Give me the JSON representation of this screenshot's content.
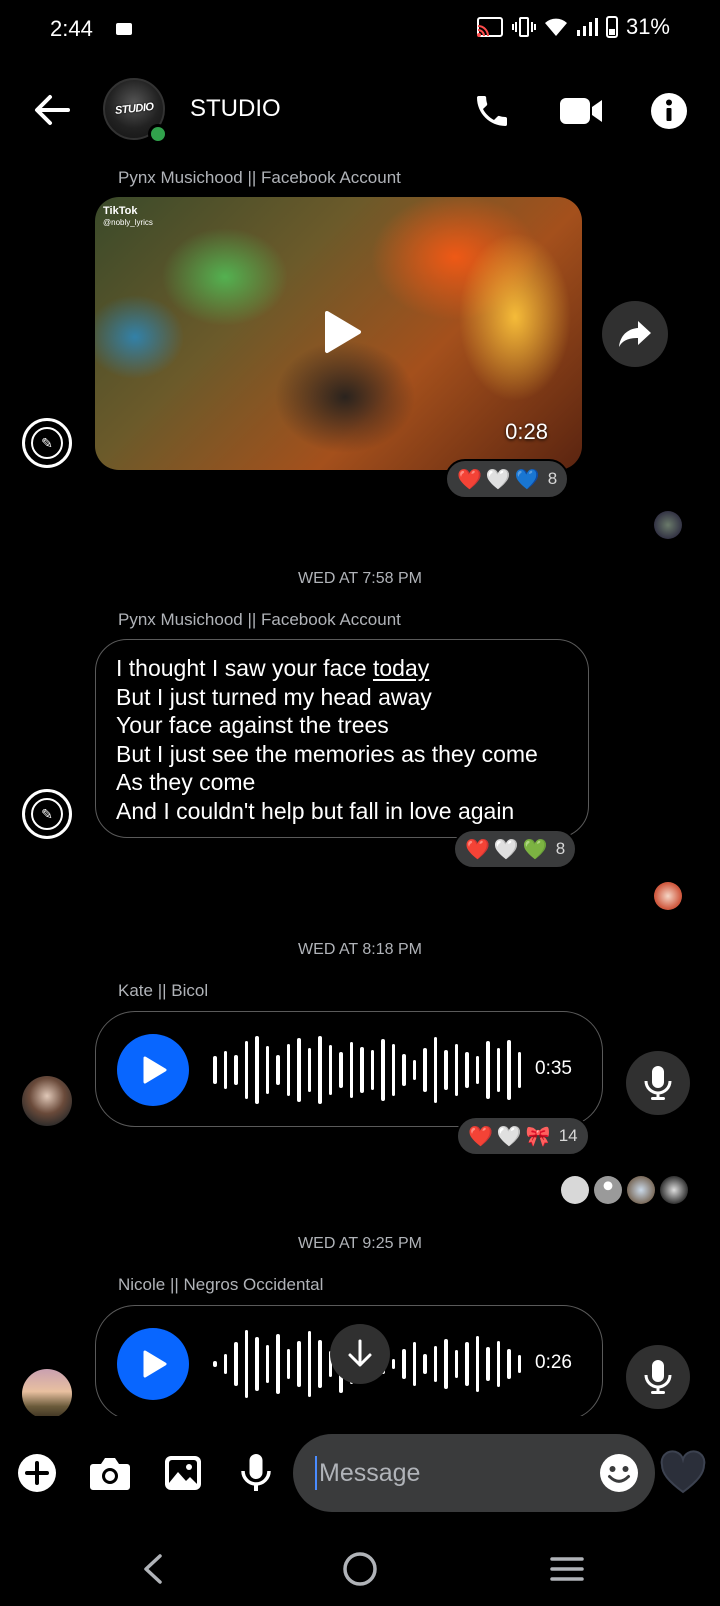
{
  "status_bar": {
    "time": "2:44",
    "battery": "31%"
  },
  "header": {
    "title": "STUDIO",
    "avatar_text": "STUDIO"
  },
  "messages": [
    {
      "sender": "Pynx Musichood || Facebook Account",
      "video": {
        "watermark": "TikTok",
        "watermark_handle": "@nobly_lyrics",
        "duration": "0:28"
      },
      "reactions": [
        "❤️",
        "🤍",
        "💙"
      ],
      "reaction_count": "8"
    },
    {
      "timestamp": "WED AT 7:58 PM",
      "sender": "Pynx Musichood || Facebook Account",
      "text_lines": [
        "I thought I saw your face ",
        "today",
        "But I just turned my head away",
        "Your face against the trees",
        "But I just see the memories as they come",
        "As they come",
        "And I couldn't help but fall in love again"
      ],
      "reactions": [
        "❤️",
        "🤍",
        "💚"
      ],
      "reaction_count": "8"
    },
    {
      "timestamp": "WED AT 8:18 PM",
      "sender": "Kate || Bicol",
      "audio_duration": "0:35",
      "reactions": [
        "❤️",
        "🤍",
        "🎀"
      ],
      "reaction_count": "14"
    },
    {
      "timestamp": "WED AT 9:25 PM",
      "sender": "Nicole || Negros Occidental",
      "audio_duration": "0:26"
    }
  ],
  "composer": {
    "placeholder": "Message"
  },
  "icons": {
    "back": "arrow-left-icon",
    "call": "phone-icon",
    "video": "video-camera-icon",
    "info": "info-icon",
    "share": "share-icon",
    "play": "play-icon",
    "mic": "microphone-icon",
    "scroll": "arrow-down-icon",
    "add": "plus-icon",
    "camera": "camera-icon",
    "gallery": "image-icon",
    "emoji": "emoji-icon",
    "like": "heart-icon"
  },
  "colors": {
    "accent": "#0866ff",
    "online": "#31a24c",
    "bubble_border": "#5a5a5a",
    "reaction_bg": "#3a3b3c"
  }
}
